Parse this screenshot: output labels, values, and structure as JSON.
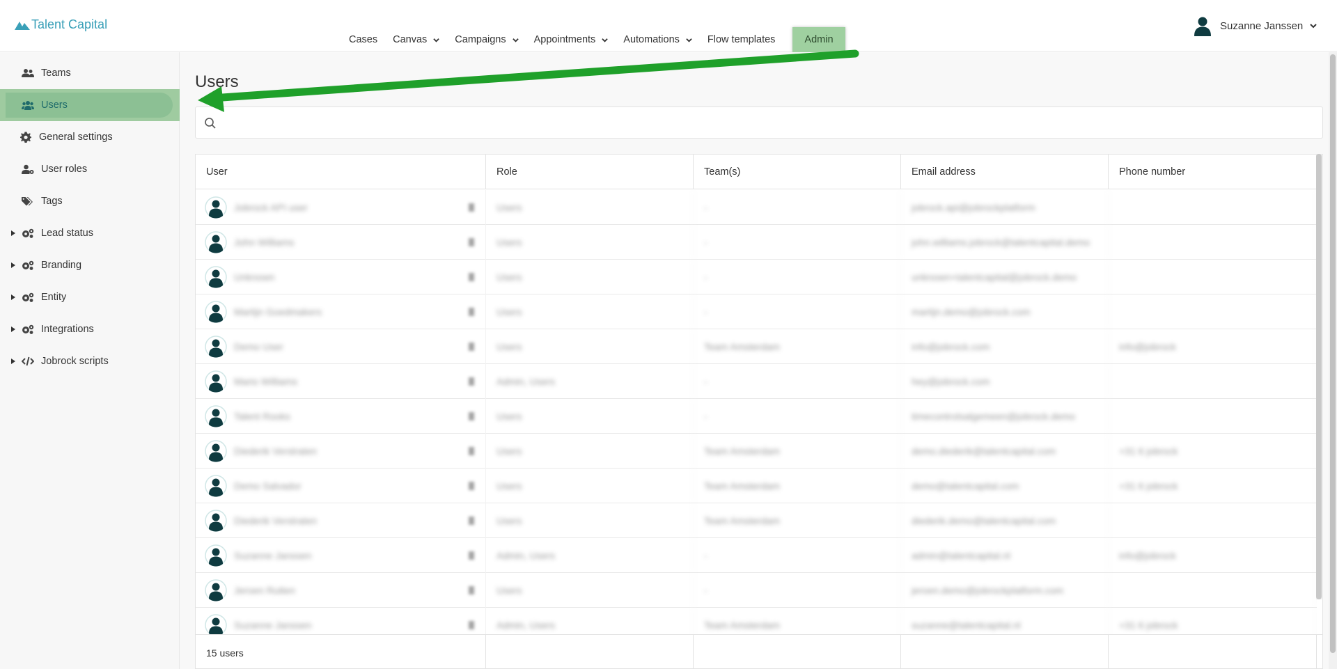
{
  "app": {
    "brand": "Talent Capital"
  },
  "topnav": {
    "items": [
      {
        "label": "Cases",
        "dropdown": false
      },
      {
        "label": "Canvas",
        "dropdown": true
      },
      {
        "label": "Campaigns",
        "dropdown": true
      },
      {
        "label": "Appointments",
        "dropdown": true
      },
      {
        "label": "Automations",
        "dropdown": true
      },
      {
        "label": "Flow templates",
        "dropdown": false
      }
    ],
    "admin_label": "Admin"
  },
  "user_menu": {
    "name": "Suzanne Janssen"
  },
  "sidebar": {
    "items": [
      {
        "label": "Teams",
        "icon": "users-icon"
      },
      {
        "label": "Users",
        "icon": "user-group-icon",
        "active": true
      },
      {
        "label": "General settings",
        "icon": "gear-icon"
      },
      {
        "label": "User roles",
        "icon": "user-gear-icon"
      },
      {
        "label": "Tags",
        "icon": "tags-icon"
      },
      {
        "label": "Lead status",
        "icon": "gears-icon",
        "expandable": true
      },
      {
        "label": "Branding",
        "icon": "gears-icon",
        "expandable": true
      },
      {
        "label": "Entity",
        "icon": "gears-icon",
        "expandable": true
      },
      {
        "label": "Integrations",
        "icon": "gears-icon",
        "expandable": true
      },
      {
        "label": "Jobrock scripts",
        "icon": "code-icon",
        "expandable": true
      }
    ]
  },
  "main": {
    "title": "Users",
    "search": {
      "value": "",
      "placeholder": ""
    },
    "table": {
      "columns": [
        "User",
        "Role",
        "Team(s)",
        "Email address",
        "Phone number"
      ],
      "rows": [
        {
          "user": "Jobrock API user",
          "role": "Users",
          "teams": "-",
          "email": "jobrock.api@jobrockplatform",
          "phone": ""
        },
        {
          "user": "John Williams",
          "role": "Users",
          "teams": "-",
          "email": "john.williams.jobrock@talentcapital.demo",
          "phone": ""
        },
        {
          "user": "Unknown",
          "role": "Users",
          "teams": "-",
          "email": "unknown+talentcapital@jobrock.demo",
          "phone": ""
        },
        {
          "user": "Martijn Goedmakers",
          "role": "Users",
          "teams": "-",
          "email": "martijn.demo@jobrock.com",
          "phone": ""
        },
        {
          "user": "Demo User",
          "role": "Users",
          "teams": "Team Amsterdam",
          "email": "info@jobrock.com",
          "phone": "info@jobrock"
        },
        {
          "user": "Mario Williams",
          "role": "Admin, Users",
          "teams": "-",
          "email": "hey@jobrock.com",
          "phone": ""
        },
        {
          "user": "Talent Rooks",
          "role": "Users",
          "teams": "-",
          "email": "timecontrolsalgemeen@jobrock.demo",
          "phone": ""
        },
        {
          "user": "Diederik Verstraten",
          "role": "Users",
          "teams": "Team Amsterdam",
          "email": "demo.diederik@talentcapital.com",
          "phone": "+31 6 jobrock"
        },
        {
          "user": "Demo Salvador",
          "role": "Users",
          "teams": "Team Amsterdam",
          "email": "demo@talentcapital.com",
          "phone": "+31 6 jobrock"
        },
        {
          "user": "Diederik Verstraten",
          "role": "Users",
          "teams": "Team Amsterdam",
          "email": "diederik.demo@talentcapital.com",
          "phone": ""
        },
        {
          "user": "Suzanne Janssen",
          "role": "Admin, Users",
          "teams": "-",
          "email": "admin@talentcapital.nl",
          "phone": "info@jobrock"
        },
        {
          "user": "Jeroen Rutten",
          "role": "Users",
          "teams": "-",
          "email": "jeroen.demo@jobrockplatform.com",
          "phone": ""
        },
        {
          "user": "Suzanne Janssen",
          "role": "Admin, Users",
          "teams": "Team Amsterdam",
          "email": "suzanne@talentcapital.nl",
          "phone": "+31 6 jobrock"
        }
      ],
      "footer": "15 users"
    }
  },
  "colors": {
    "brand": "#3aa0b8",
    "highlight": "#9fd0a0",
    "arrow": "#1fa02a",
    "avatar": "#0f3b40"
  }
}
